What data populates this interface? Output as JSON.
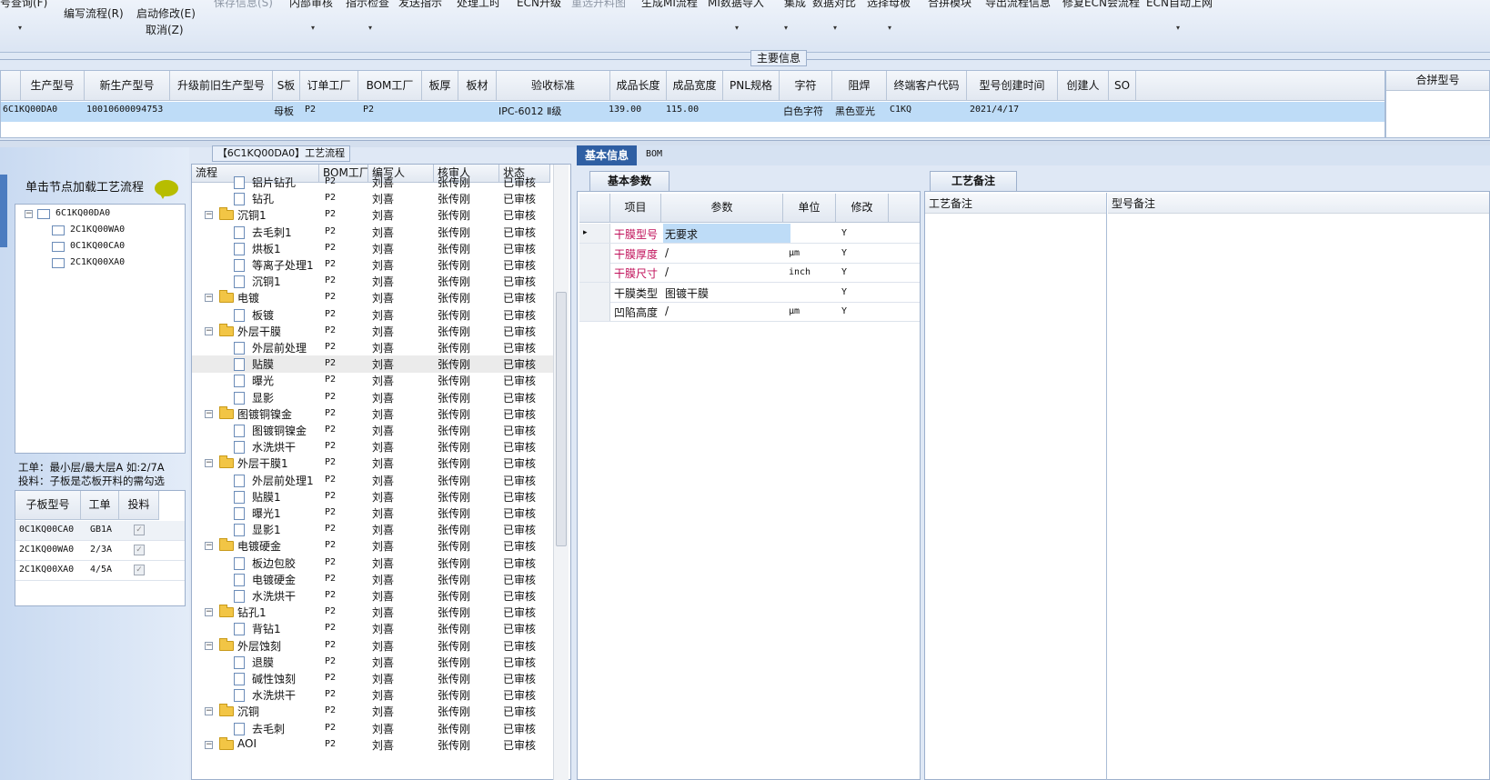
{
  "toolbar": {
    "items": [
      {
        "label": "号查询(F)",
        "disabled": false
      },
      {
        "label": "编写流程(R)",
        "disabled": false
      },
      {
        "label": "启动修改(E)",
        "disabled": false
      },
      {
        "label": "取消(Z)",
        "disabled": false
      },
      {
        "label": "保存信息(S)",
        "disabled": true
      },
      {
        "label": "内部审核",
        "disabled": false
      },
      {
        "label": "指示检查",
        "disabled": false
      },
      {
        "label": "发送指示",
        "disabled": false
      },
      {
        "label": "处理工时",
        "disabled": false
      },
      {
        "label": "ECN升级",
        "disabled": false
      },
      {
        "label": "重选开料图",
        "disabled": true
      },
      {
        "label": "生成MI流程",
        "disabled": false
      },
      {
        "label": "MI数据导入",
        "disabled": false
      },
      {
        "label": "集成",
        "disabled": false
      },
      {
        "label": "数据对比",
        "disabled": false
      },
      {
        "label": "选择母板",
        "disabled": false
      },
      {
        "label": "合拼模块",
        "disabled": false
      },
      {
        "label": "导出流程信息",
        "disabled": false
      },
      {
        "label": "修复ECN会流程",
        "disabled": false
      },
      {
        "label": "ECN自动上网",
        "disabled": false
      }
    ]
  },
  "main_info": {
    "label": "主要信息",
    "columns": [
      "生产型号",
      "新生产型号",
      "升级前旧生产型号",
      "S板",
      "订单工厂",
      "BOM工厂",
      "板厚",
      "板材",
      "验收标准",
      "成品长度",
      "成品宽度",
      "PNL规格",
      "字符",
      "阻焊",
      "终端客户代码",
      "型号创建时间",
      "创建人",
      "SO"
    ],
    "row": [
      "6C1KQ00DA0",
      "10010600094753",
      "",
      "母板",
      "P2",
      "P2",
      "",
      "",
      "IPC-6012 Ⅱ级",
      "139.00",
      "115.00",
      "",
      "白色字符",
      "黑色亚光",
      "C1KQ",
      "2021/4/17",
      "",
      ""
    ],
    "merge_label": "合拼型号"
  },
  "left_panel": {
    "tree_header": "单击节点加载工艺流程",
    "root": "6C1KQ00DA0",
    "children": [
      "2C1KQ00WA0",
      "0C1KQ00CA0",
      "2C1KQ00XA0"
    ],
    "hint_line1": "工单：最小层/最大层A 如:2/7A",
    "hint_line2": "投料：子板是芯板开料的需勾选",
    "sub_columns": [
      "子板型号",
      "工单",
      "投料"
    ],
    "sub_rows": [
      {
        "model": "0C1KQ00CA0",
        "order": "GB1A",
        "feed": true
      },
      {
        "model": "2C1KQ00WA0",
        "order": "2/3A",
        "feed": true
      },
      {
        "model": "2C1KQ00XA0",
        "order": "4/5A",
        "feed": true
      }
    ]
  },
  "process": {
    "title": "【6C1KQ00DA0】工艺流程",
    "columns": [
      "流程",
      "BOM工厂",
      "编写人",
      "核审人",
      "状态"
    ],
    "rows": [
      {
        "name": "铝片钻孔",
        "type": "leaf"
      },
      {
        "name": "钻孔",
        "type": "leaf"
      },
      {
        "name": "沉铜1",
        "type": "folder"
      },
      {
        "name": "去毛刺1",
        "type": "leaf"
      },
      {
        "name": "烘板1",
        "type": "leaf"
      },
      {
        "name": "等离子处理1",
        "type": "leaf"
      },
      {
        "name": "沉铜1",
        "type": "leaf"
      },
      {
        "name": "电镀",
        "type": "folder"
      },
      {
        "name": "板镀",
        "type": "leaf"
      },
      {
        "name": "外层干膜",
        "type": "folder"
      },
      {
        "name": "外层前处理",
        "type": "leaf"
      },
      {
        "name": "贴膜",
        "type": "leaf",
        "hl": true
      },
      {
        "name": "曝光",
        "type": "leaf"
      },
      {
        "name": "显影",
        "type": "leaf"
      },
      {
        "name": "图镀铜镍金",
        "type": "folder"
      },
      {
        "name": "图镀铜镍金",
        "type": "leaf"
      },
      {
        "name": "水洗烘干",
        "type": "leaf"
      },
      {
        "name": "外层干膜1",
        "type": "folder"
      },
      {
        "name": "外层前处理1",
        "type": "leaf"
      },
      {
        "name": "贴膜1",
        "type": "leaf"
      },
      {
        "name": "曝光1",
        "type": "leaf"
      },
      {
        "name": "显影1",
        "type": "leaf"
      },
      {
        "name": "电镀硬金",
        "type": "folder"
      },
      {
        "name": "板边包胶",
        "type": "leaf"
      },
      {
        "name": "电镀硬金",
        "type": "leaf"
      },
      {
        "name": "水洗烘干",
        "type": "leaf"
      },
      {
        "name": "钻孔1",
        "type": "folder"
      },
      {
        "name": "背钻1",
        "type": "leaf"
      },
      {
        "name": "外层蚀刻",
        "type": "folder"
      },
      {
        "name": "退膜",
        "type": "leaf"
      },
      {
        "name": "碱性蚀刻",
        "type": "leaf"
      },
      {
        "name": "水洗烘干",
        "type": "leaf"
      },
      {
        "name": "沉铜",
        "type": "folder"
      },
      {
        "name": "去毛刺",
        "type": "leaf"
      },
      {
        "name": "AOI",
        "type": "folder"
      }
    ],
    "bom": "P2",
    "writer": "刘喜",
    "reviewer": "张传刚",
    "status": "已审核"
  },
  "info_tabs": {
    "basic": "基本信息",
    "bom": "BOM"
  },
  "params": {
    "tab": "基本参数",
    "columns": [
      "项目",
      "参数",
      "单位",
      "修改"
    ],
    "rows": [
      {
        "item": "干膜型号",
        "value": "无要求",
        "unit": "",
        "edit": "Y",
        "red": true
      },
      {
        "item": "干膜厚度",
        "value": "/",
        "unit": "μm",
        "edit": "Y",
        "red": true
      },
      {
        "item": "干膜尺寸",
        "value": "/",
        "unit": "inch",
        "edit": "Y",
        "red": true
      },
      {
        "item": "干膜类型",
        "value": "图镀干膜",
        "unit": "",
        "edit": "Y",
        "red": false
      },
      {
        "item": "凹陷高度",
        "value": "/",
        "unit": "μm",
        "edit": "Y",
        "red": false
      }
    ]
  },
  "remarks": {
    "tab": "工艺备注",
    "process_remark": "工艺备注",
    "model_remark": "型号备注"
  },
  "colors": {
    "accent": "#2f5fa3",
    "selection": "#bedcf7",
    "red_text": "#c0105a"
  }
}
